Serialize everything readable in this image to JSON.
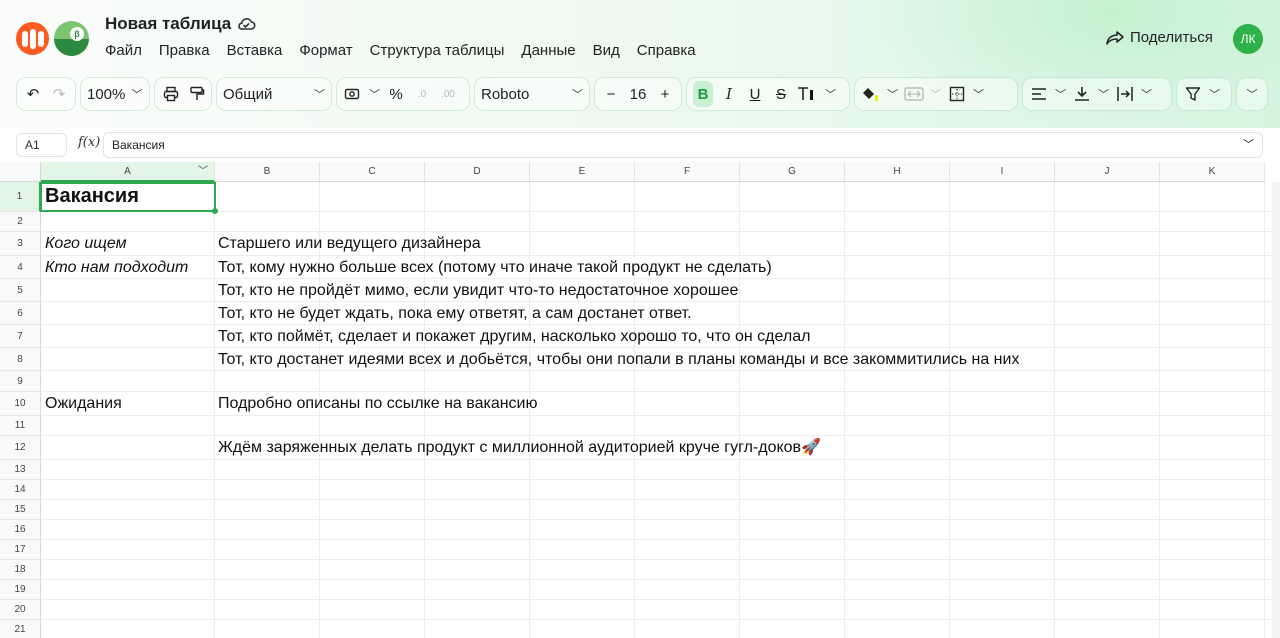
{
  "app": {
    "title": "Новая таблица",
    "menu": [
      "Файл",
      "Правка",
      "Вставка",
      "Формат",
      "Структура таблицы",
      "Данные",
      "Вид",
      "Справка"
    ],
    "share_label": "Поделиться",
    "avatar_initials": "ЛК",
    "brand_color": "#2fb14a"
  },
  "toolbar": {
    "zoom": "100%",
    "number_format": "Общий",
    "percent": "%",
    "dec_decrease": ".0",
    "dec_increase": ".00",
    "font_name": "Roboto",
    "font_size": "16",
    "minus": "−",
    "plus": "+",
    "bold": "B",
    "italic": "I",
    "underline": "U",
    "strike": "S"
  },
  "formula_bar": {
    "cell_ref": "A1",
    "fx": "f(x)",
    "value": "Вакансия"
  },
  "columns": [
    "A",
    "B",
    "C",
    "D",
    "E",
    "F",
    "G",
    "H",
    "I",
    "J",
    "K"
  ],
  "rows": [
    "1",
    "2",
    "3",
    "4",
    "5",
    "6",
    "7",
    "8",
    "9",
    "10",
    "11",
    "12",
    "13",
    "14",
    "15",
    "16",
    "17",
    "18",
    "19",
    "20",
    "21"
  ],
  "cells": {
    "a1": "Вакансия",
    "a3": "Кого ищем",
    "b3": "Старшего или ведущего дизайнера",
    "a4": "Кто нам подходит",
    "b4": "Тот, кому нужно больше всех (потому что иначе такой продукт не сделать)",
    "b5": "Тот, кто не пройдёт мимо, если увидит что-то недостаточное хорошее",
    "b6": "Тот, кто не будет ждать, пока ему ответят, а сам достанет ответ.",
    "b7": "Тот, кто поймёт, сделает и покажет другим, насколько хорошо то, что он сделал",
    "b8": "Тот, кто достанет идеями всех и добьётся, чтобы они попали в планы команды и все закоммитились на них",
    "a10": "Ожидания",
    "b10": "Подробно описаны по ссылке на вакансию",
    "b12": "Ждём заряженных делать продукт с миллионной аудиторией круче гугл-доков🚀"
  }
}
